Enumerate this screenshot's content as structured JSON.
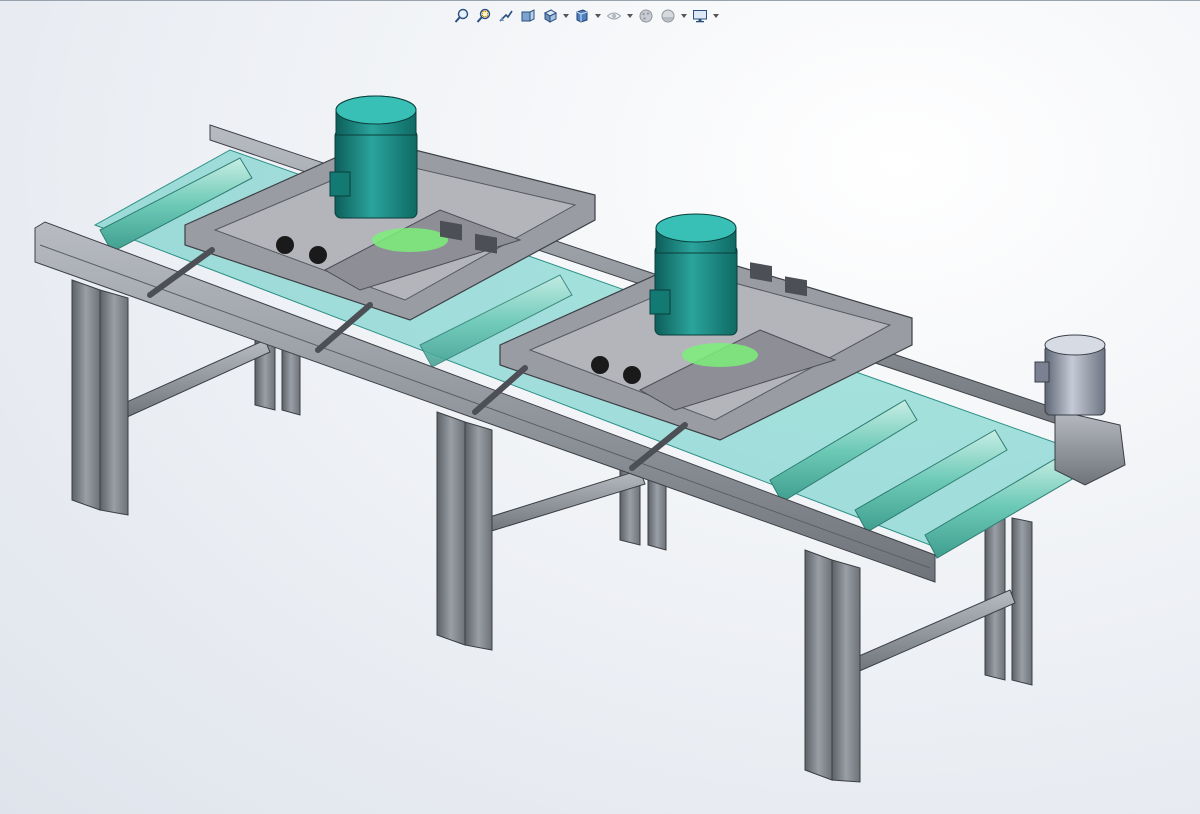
{
  "toolbar": {
    "buttons": [
      {
        "icon": "zoom-to-fit-icon"
      },
      {
        "icon": "zoom-to-area-icon"
      },
      {
        "icon": "previous-view-icon"
      },
      {
        "icon": "section-view-icon"
      },
      {
        "icon": "view-orientation-icon",
        "dropdown": true
      },
      {
        "icon": "display-style-icon",
        "dropdown": true
      },
      {
        "icon": "hide-show-items-icon",
        "dropdown": true
      },
      {
        "icon": "edit-appearance-icon"
      },
      {
        "icon": "apply-scene-icon",
        "dropdown": true
      },
      {
        "icon": "view-settings-icon",
        "dropdown": true
      }
    ]
  },
  "viewport": {
    "model": "roller-conveyor-assembly"
  },
  "colors": {
    "frame": "#8f949b",
    "roller": "#8fd3c6",
    "belt": "#3fc3b8",
    "motor": "#1f8f8a",
    "small_motor": "#9ea6b5",
    "plate": "#8e8f96",
    "background": "#eef1f5"
  }
}
